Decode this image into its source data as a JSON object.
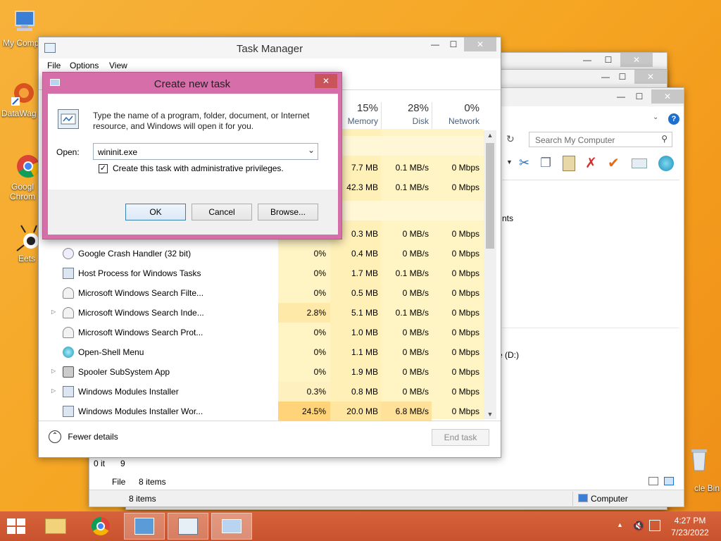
{
  "desktop": {
    "icons": [
      {
        "label": "My Comp"
      },
      {
        "label": "DataWag"
      },
      {
        "label": "Googl Chrom"
      },
      {
        "label": "Eets"
      },
      {
        "label": "cle Bin"
      }
    ]
  },
  "explorer_back": {
    "search_placeholder": "Search My Computer",
    "side_text_1": "nts",
    "side_text_2": "e (D:)",
    "status_items": "8 items",
    "status_items_2": "8 items",
    "status_computer": "Computer",
    "file_menu": "File",
    "left_clip_1": "0 it",
    "left_clip_2": "9"
  },
  "task_manager": {
    "title": "Task Manager",
    "menu": [
      "File",
      "Options",
      "View"
    ],
    "headers": {
      "memory_pct": "15%",
      "memory": "Memory",
      "disk_pct": "28%",
      "disk": "Disk",
      "network_pct": "0%",
      "network": "Network"
    },
    "hidden_rows": [
      {
        "memory": "7.7 MB",
        "disk": "0.1 MB/s",
        "network": "0 Mbps"
      },
      {
        "memory": "42.3 MB",
        "disk": "0.1 MB/s",
        "network": "0 Mbps"
      },
      {
        "memory": "0.3 MB",
        "disk": "0 MB/s",
        "network": "0 Mbps"
      }
    ],
    "rows": [
      {
        "name": "Google Crash Handler (32 bit)",
        "cpu": "0%",
        "memory": "0.4 MB",
        "disk": "0 MB/s",
        "network": "0 Mbps"
      },
      {
        "name": "Host Process for Windows Tasks",
        "cpu": "0%",
        "memory": "1.7 MB",
        "disk": "0.1 MB/s",
        "network": "0 Mbps"
      },
      {
        "name": "Microsoft Windows Search Filte...",
        "cpu": "0%",
        "memory": "0.5 MB",
        "disk": "0 MB/s",
        "network": "0 Mbps"
      },
      {
        "name": "Microsoft Windows Search Inde...",
        "cpu": "2.8%",
        "memory": "5.1 MB",
        "disk": "0.1 MB/s",
        "network": "0 Mbps"
      },
      {
        "name": "Microsoft Windows Search Prot...",
        "cpu": "0%",
        "memory": "1.0 MB",
        "disk": "0 MB/s",
        "network": "0 Mbps"
      },
      {
        "name": "Open-Shell Menu",
        "cpu": "0%",
        "memory": "1.1 MB",
        "disk": "0 MB/s",
        "network": "0 Mbps"
      },
      {
        "name": "Spooler SubSystem App",
        "cpu": "0%",
        "memory": "1.9 MB",
        "disk": "0 MB/s",
        "network": "0 Mbps"
      },
      {
        "name": "Windows Modules Installer",
        "cpu": "0.3%",
        "memory": "0.8 MB",
        "disk": "0 MB/s",
        "network": "0 Mbps"
      },
      {
        "name": "Windows Modules Installer Wor...",
        "cpu": "24.5%",
        "memory": "20.0 MB",
        "disk": "6.8 MB/s",
        "network": "0 Mbps"
      }
    ],
    "fewer_details": "Fewer details",
    "end_task": "End task"
  },
  "create_task": {
    "title": "Create new task",
    "description": "Type the name of a program, folder, document, or Internet resource, and Windows will open it for you.",
    "open_label": "Open:",
    "open_value": "wininit.exe",
    "admin_label": "Create this task with administrative privileges.",
    "ok": "OK",
    "cancel": "Cancel",
    "browse": "Browse..."
  },
  "taskbar": {
    "time": "4:27 PM",
    "date": "7/23/2022"
  }
}
